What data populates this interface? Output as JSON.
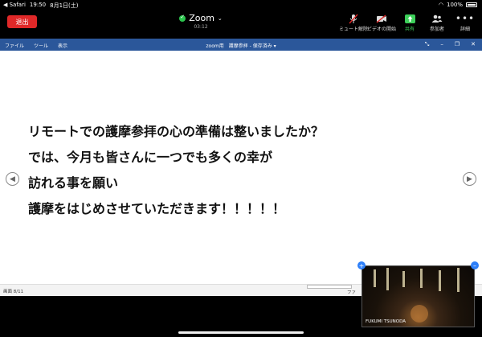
{
  "status_bar": {
    "back_app": "◀ Safari",
    "time": "19:50",
    "date": "8月1日(土)",
    "battery": "100%"
  },
  "toolbar": {
    "leave_label": "退出",
    "meeting_title": "Zoom",
    "meeting_timer": "03:12",
    "buttons": {
      "mute": "ミュート解除",
      "video": "ビデオの開始",
      "share": "共有",
      "participants": "参加者",
      "more": "詳細"
    }
  },
  "ppt": {
    "menu": [
      "ファイル",
      "ツール",
      "表示"
    ],
    "doc_title": "zoom用　護摩参拝 - 保存済み ▾",
    "slide_lines": [
      "リモートでの護摩参拝の心の準備は整いましたか？",
      "では、今月も皆さんに一つでも多くの幸が",
      "訪れる事を願い",
      "護摩をはじめさせていただきます！！！！！"
    ],
    "slide_counter": "画面 8/11",
    "status_right": "ファ"
  },
  "video": {
    "participant_name": "FUKUMI TSUNODA"
  },
  "colors": {
    "leave": "#e02828",
    "share_accent": "#3dd05a",
    "ppt_blue": "#2b579a",
    "pip_blue": "#2d7ff9"
  },
  "icons": [
    "mic-off-icon",
    "video-off-icon",
    "share-arrow-icon",
    "participants-icon",
    "more-dots-icon",
    "shield-check-icon",
    "chevron-left-icon",
    "chevron-right-icon"
  ]
}
